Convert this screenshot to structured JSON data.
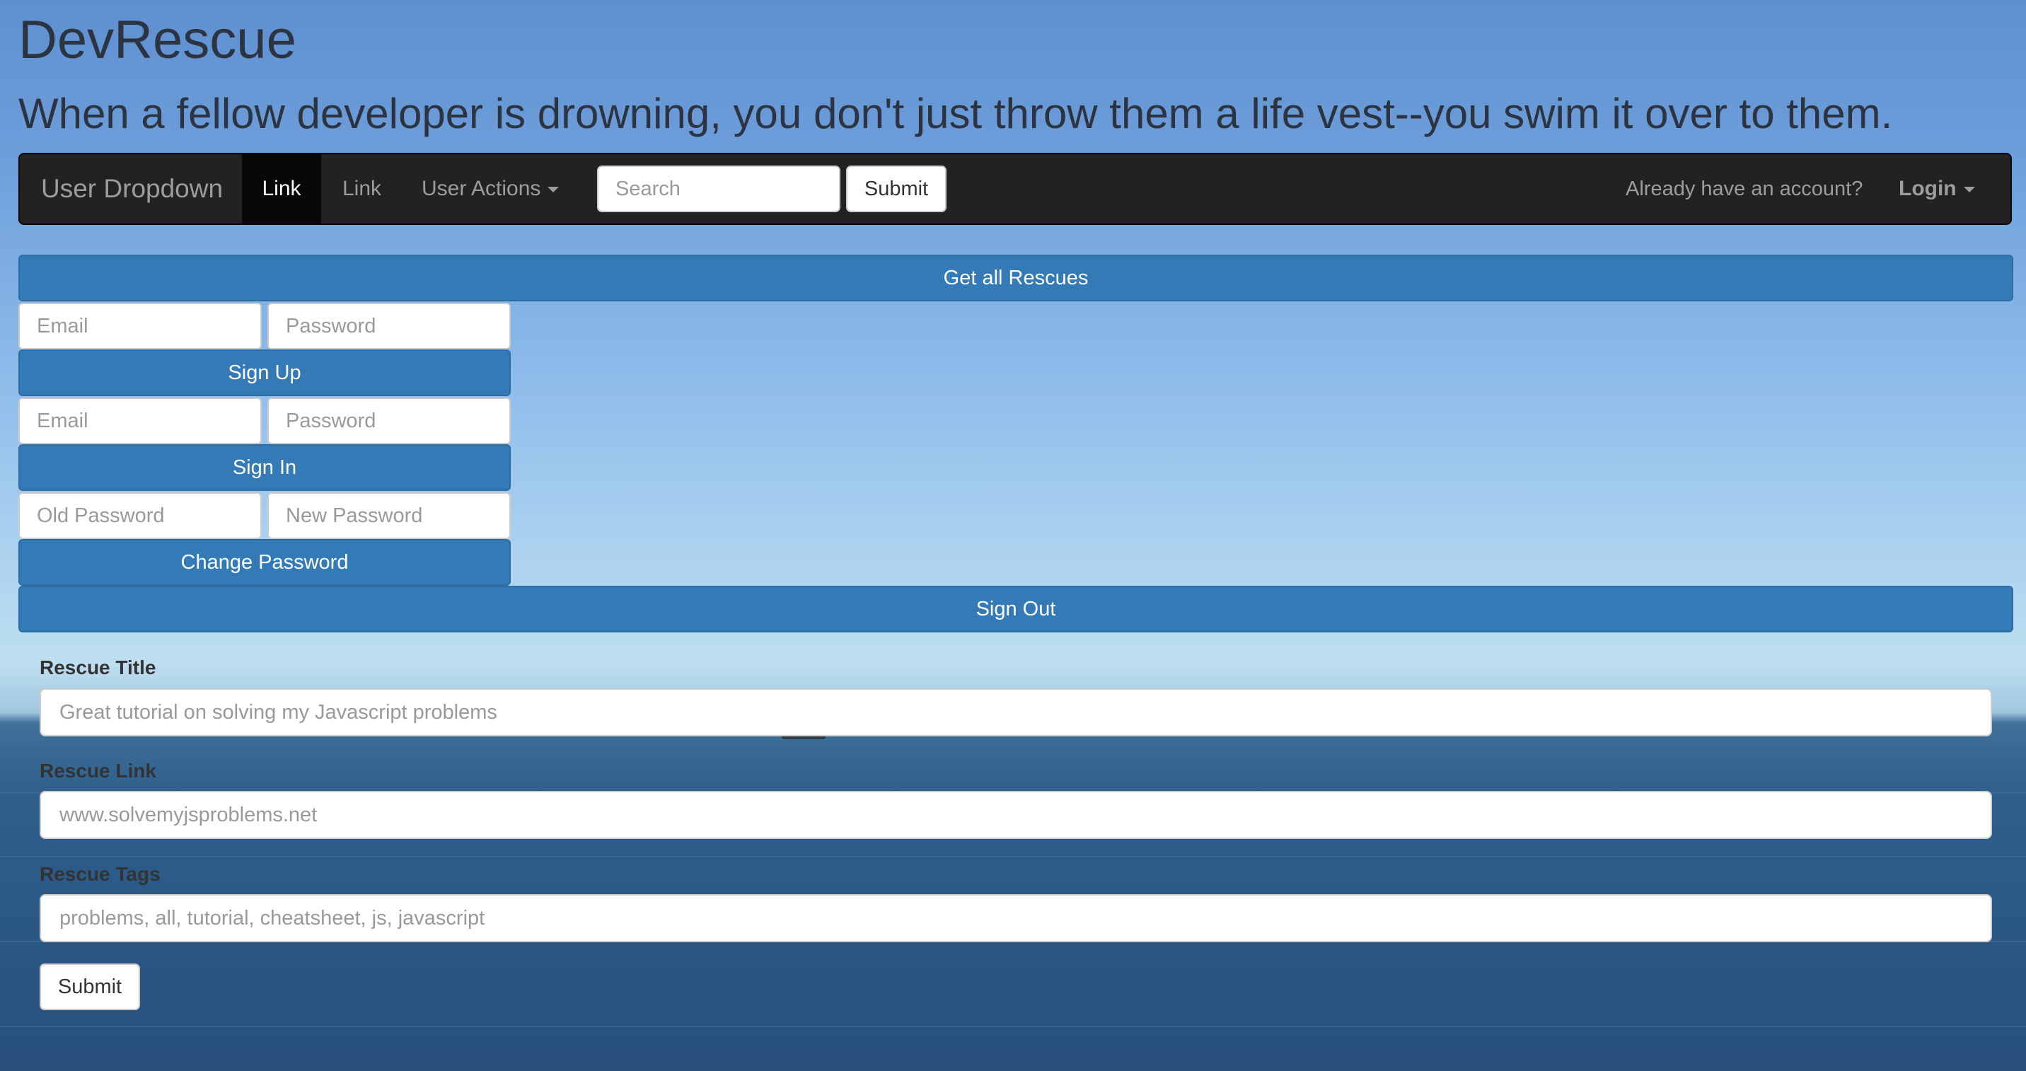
{
  "site": {
    "title": "DevRescue",
    "tagline": "When a fellow developer is drowning, you don't just throw them a life vest--you swim it over to them."
  },
  "navbar": {
    "brand": "User Dropdown",
    "active_link": "Link",
    "link2": "Link",
    "user_actions": "User Actions",
    "search_placeholder": "Search",
    "submit_label": "Submit",
    "account_prompt": "Already have an account?",
    "login_label": "Login"
  },
  "actions": {
    "get_all_rescues": "Get all Rescues",
    "sign_out": "Sign Out"
  },
  "sign_up": {
    "email_placeholder": "Email",
    "password_placeholder": "Password",
    "button": "Sign Up"
  },
  "sign_in": {
    "email_placeholder": "Email",
    "password_placeholder": "Password",
    "button": "Sign In"
  },
  "change_password": {
    "old_placeholder": "Old Password",
    "new_placeholder": "New Password",
    "button": "Change Password"
  },
  "rescue_form": {
    "title_label": "Rescue Title",
    "title_placeholder": "Great tutorial on solving my Javascript problems",
    "link_label": "Rescue Link",
    "link_placeholder": "www.solvemyjsproblems.net",
    "tags_label": "Rescue Tags",
    "tags_placeholder": "problems, all, tutorial, cheatsheet, js, javascript",
    "submit_label": "Submit"
  },
  "colors": {
    "primary": "#337ab7",
    "navbar_bg": "#222222"
  }
}
